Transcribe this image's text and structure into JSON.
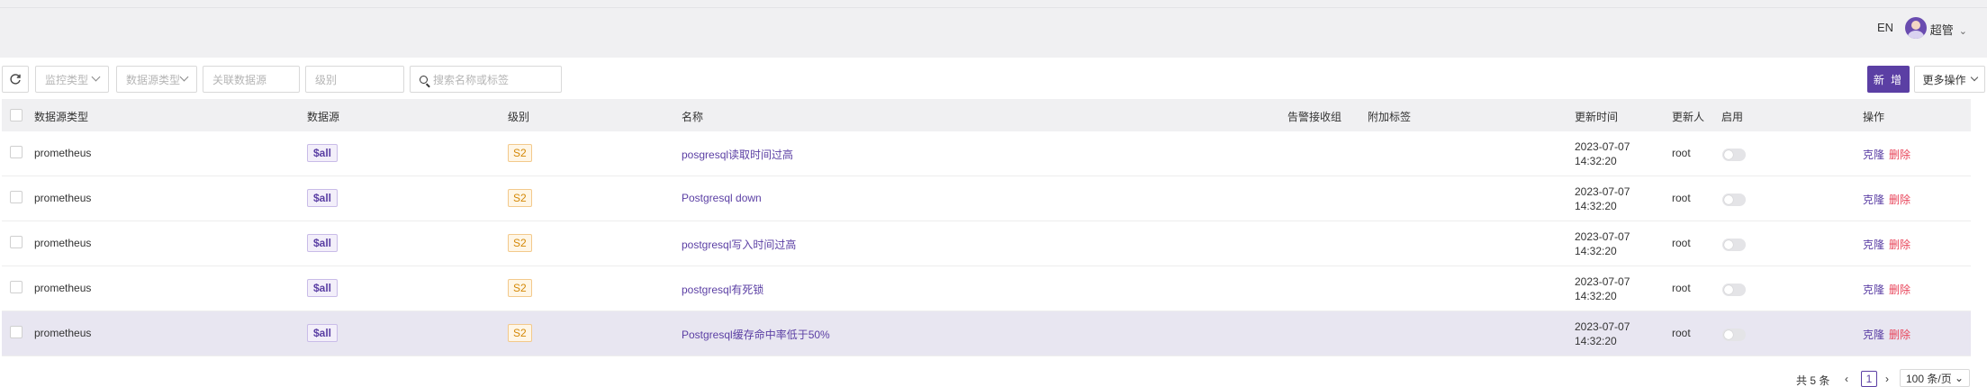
{
  "header": {
    "lang": "EN",
    "user_name": "超管"
  },
  "toolbar": {
    "refresh_icon": "refresh-icon",
    "monitor_type_placeholder": "监控类型",
    "datasource_type_placeholder": "数据源类型",
    "related_datasource_placeholder": "关联数据源",
    "level_placeholder": "级别",
    "search_placeholder": "搜索名称或标签",
    "new_label": "新 增",
    "more_label": "更多操作"
  },
  "table": {
    "columns": {
      "datasource_type": "数据源类型",
      "datasource": "数据源",
      "level": "级别",
      "name": "名称",
      "alert_group": "告警接收组",
      "extra_tags": "附加标签",
      "updated_at": "更新时间",
      "updated_by": "更新人",
      "enabled": "启用",
      "actions": "操作"
    },
    "rows": [
      {
        "type": "prometheus",
        "datasource": "$all",
        "level": "S2",
        "name": "posgresql读取时间过高",
        "date": "2023-07-07",
        "time": "14:32:20",
        "user": "root",
        "enabled": false,
        "clone": "克隆",
        "delete": "删除"
      },
      {
        "type": "prometheus",
        "datasource": "$all",
        "level": "S2",
        "name": "Postgresql down",
        "date": "2023-07-07",
        "time": "14:32:20",
        "user": "root",
        "enabled": false,
        "clone": "克隆",
        "delete": "删除"
      },
      {
        "type": "prometheus",
        "datasource": "$all",
        "level": "S2",
        "name": "postgresql写入时间过高",
        "date": "2023-07-07",
        "time": "14:32:20",
        "user": "root",
        "enabled": false,
        "clone": "克隆",
        "delete": "删除"
      },
      {
        "type": "prometheus",
        "datasource": "$all",
        "level": "S2",
        "name": "postgresql有死锁",
        "date": "2023-07-07",
        "time": "14:32:20",
        "user": "root",
        "enabled": false,
        "clone": "克隆",
        "delete": "删除"
      },
      {
        "type": "prometheus",
        "datasource": "$all",
        "level": "S2",
        "name": "Postgresql缓存命中率低于50%",
        "date": "2023-07-07",
        "time": "14:32:20",
        "user": "root",
        "enabled": false,
        "clone": "克隆",
        "delete": "删除"
      }
    ]
  },
  "pagination": {
    "total": "共 5 条",
    "current_page": "1",
    "page_size": "100 条/页"
  },
  "colors": {
    "primary": "#5b3fa4",
    "danger": "#e8445a",
    "tag_warn": "#d48806"
  }
}
